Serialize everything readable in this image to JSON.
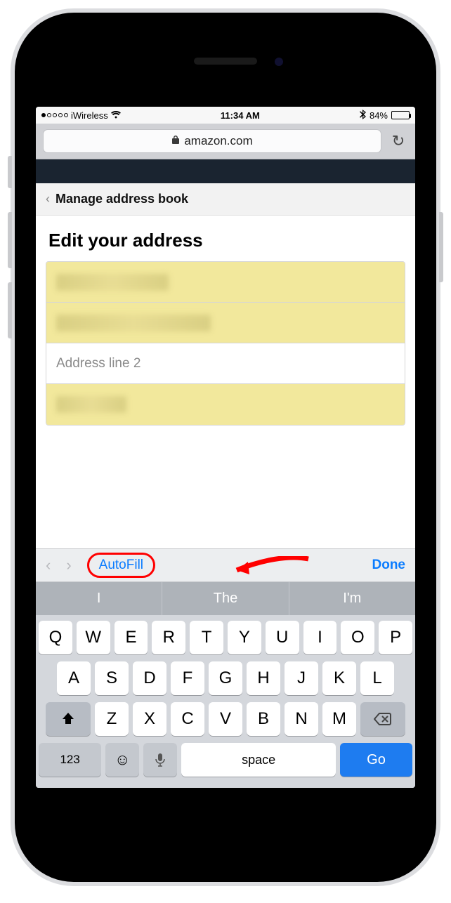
{
  "status": {
    "carrier": "iWireless",
    "time": "11:34 AM",
    "battery_pct": "84%"
  },
  "browser": {
    "domain": "amazon.com"
  },
  "page": {
    "breadcrumb": "Manage address book",
    "title": "Edit your address",
    "address_line2_placeholder": "Address line 2"
  },
  "kb_accessory": {
    "autofill": "AutoFill",
    "done": "Done"
  },
  "predictions": [
    "I",
    "The",
    "I'm"
  ],
  "keyboard": {
    "row1": [
      "Q",
      "W",
      "E",
      "R",
      "T",
      "Y",
      "U",
      "I",
      "O",
      "P"
    ],
    "row2": [
      "A",
      "S",
      "D",
      "F",
      "G",
      "H",
      "J",
      "K",
      "L"
    ],
    "row3": [
      "Z",
      "X",
      "C",
      "V",
      "B",
      "N",
      "M"
    ],
    "num_key": "123",
    "space": "space",
    "go": "Go"
  }
}
